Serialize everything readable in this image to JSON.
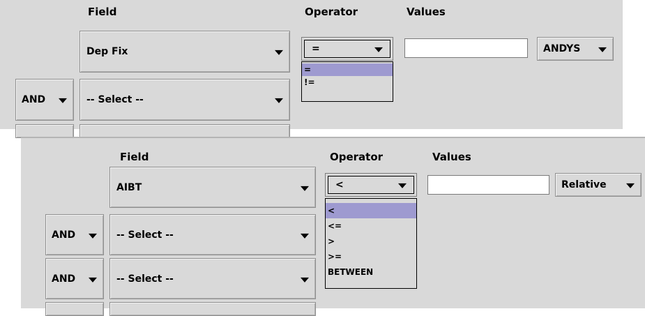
{
  "panel_top": {
    "headers": {
      "field": "Field",
      "operator": "Operator",
      "values": "Values"
    },
    "rows": [
      {
        "field": "Dep Fix"
      },
      {
        "conjunction": "AND",
        "field": "-- Select --"
      }
    ],
    "operator": {
      "selected": "=",
      "options": [
        "=",
        "!="
      ]
    },
    "value": "",
    "mode": "ANDYS"
  },
  "panel_bottom": {
    "headers": {
      "field": "Field",
      "operator": "Operator",
      "values": "Values"
    },
    "rows": [
      {
        "field": "AIBT"
      },
      {
        "conjunction": "AND",
        "field": "-- Select --"
      },
      {
        "conjunction": "AND",
        "field": "-- Select --"
      }
    ],
    "operator": {
      "selected": "<",
      "options": [
        "<",
        "<=",
        ">",
        ">=",
        "BETWEEN"
      ]
    },
    "value": "",
    "mode": "Relative"
  }
}
